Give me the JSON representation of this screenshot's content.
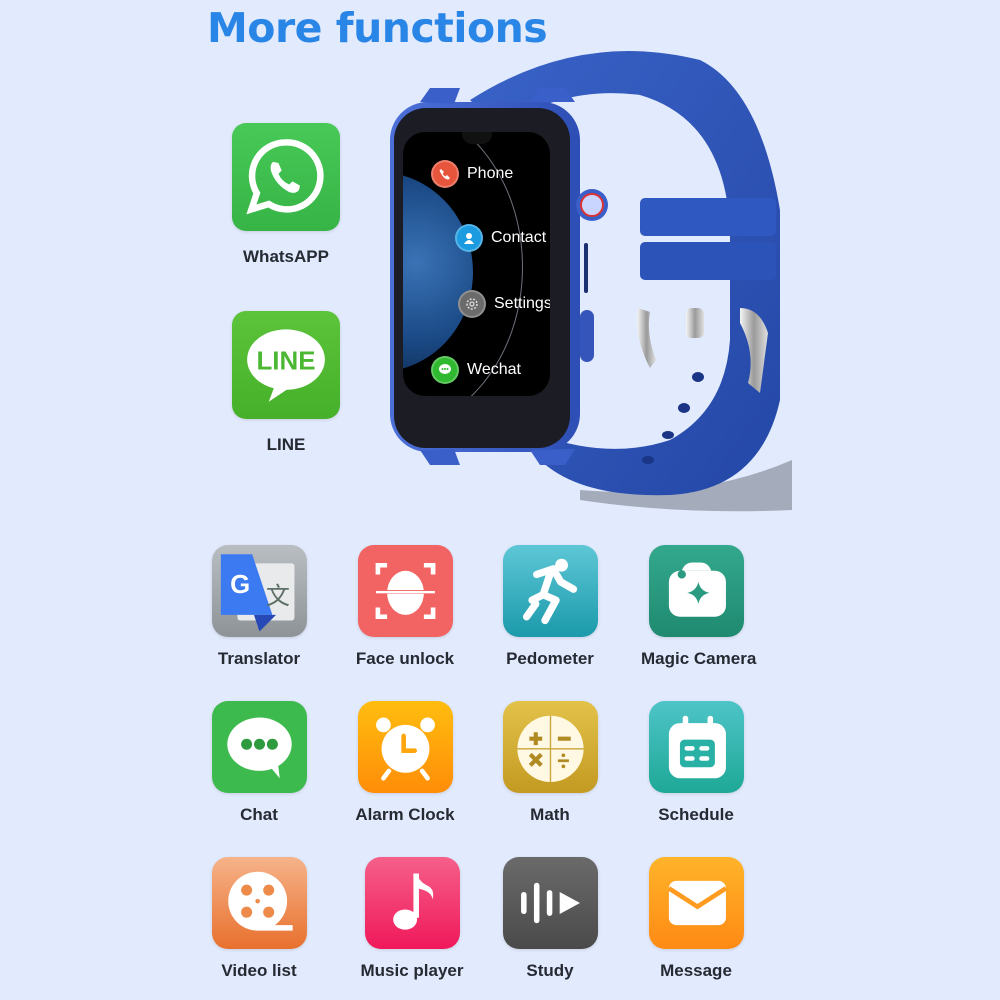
{
  "page": {
    "title": "More functions",
    "background_color": "#e2eafd",
    "title_color": "#2a86e6"
  },
  "featured_apps": [
    {
      "label": "WhatsAPP",
      "icon": "whatsapp-icon",
      "color": "#3fbf4d"
    },
    {
      "label": "LINE",
      "icon": "line-icon",
      "color": "#4cb733"
    }
  ],
  "watch": {
    "band_color": "#2f55b8",
    "screen_menu": [
      {
        "label": "Phone",
        "icon": "phone-icon",
        "color": "#e8553d"
      },
      {
        "label": "Contact",
        "icon": "contact-icon",
        "color": "#1c9be0"
      },
      {
        "label": "Settings",
        "icon": "settings-icon",
        "color": "#6b6b6b"
      },
      {
        "label": "Wechat",
        "icon": "wechat-icon",
        "color": "#2fb830"
      }
    ]
  },
  "apps_grid": [
    {
      "label": "Translator",
      "icon": "translator-icon",
      "color": "#9ea3a8"
    },
    {
      "label": "Face unlock",
      "icon": "face-unlock-icon",
      "color": "#f26464"
    },
    {
      "label": "Pedometer",
      "icon": "pedometer-icon",
      "color": "#26a9b7"
    },
    {
      "label": "Magic Camera",
      "icon": "magic-camera-icon",
      "color": "#2a9a80"
    },
    {
      "label": "Chat",
      "icon": "chat-icon",
      "color": "#3dba4e"
    },
    {
      "label": "Alarm Clock",
      "icon": "alarm-clock-icon",
      "color": "#ffa60f"
    },
    {
      "label": "Math",
      "icon": "math-icon",
      "color": "#d1aa33"
    },
    {
      "label": "Schedule",
      "icon": "schedule-icon",
      "color": "#2ab1a6"
    },
    {
      "label": "Video list",
      "icon": "video-list-icon",
      "color": "#ee8a4a"
    },
    {
      "label": "Music player",
      "icon": "music-player-icon",
      "color": "#f2356d"
    },
    {
      "label": "Study",
      "icon": "study-icon",
      "color": "#5b5b5b"
    },
    {
      "label": "Message",
      "icon": "message-icon",
      "color": "#ff9b1f"
    }
  ]
}
